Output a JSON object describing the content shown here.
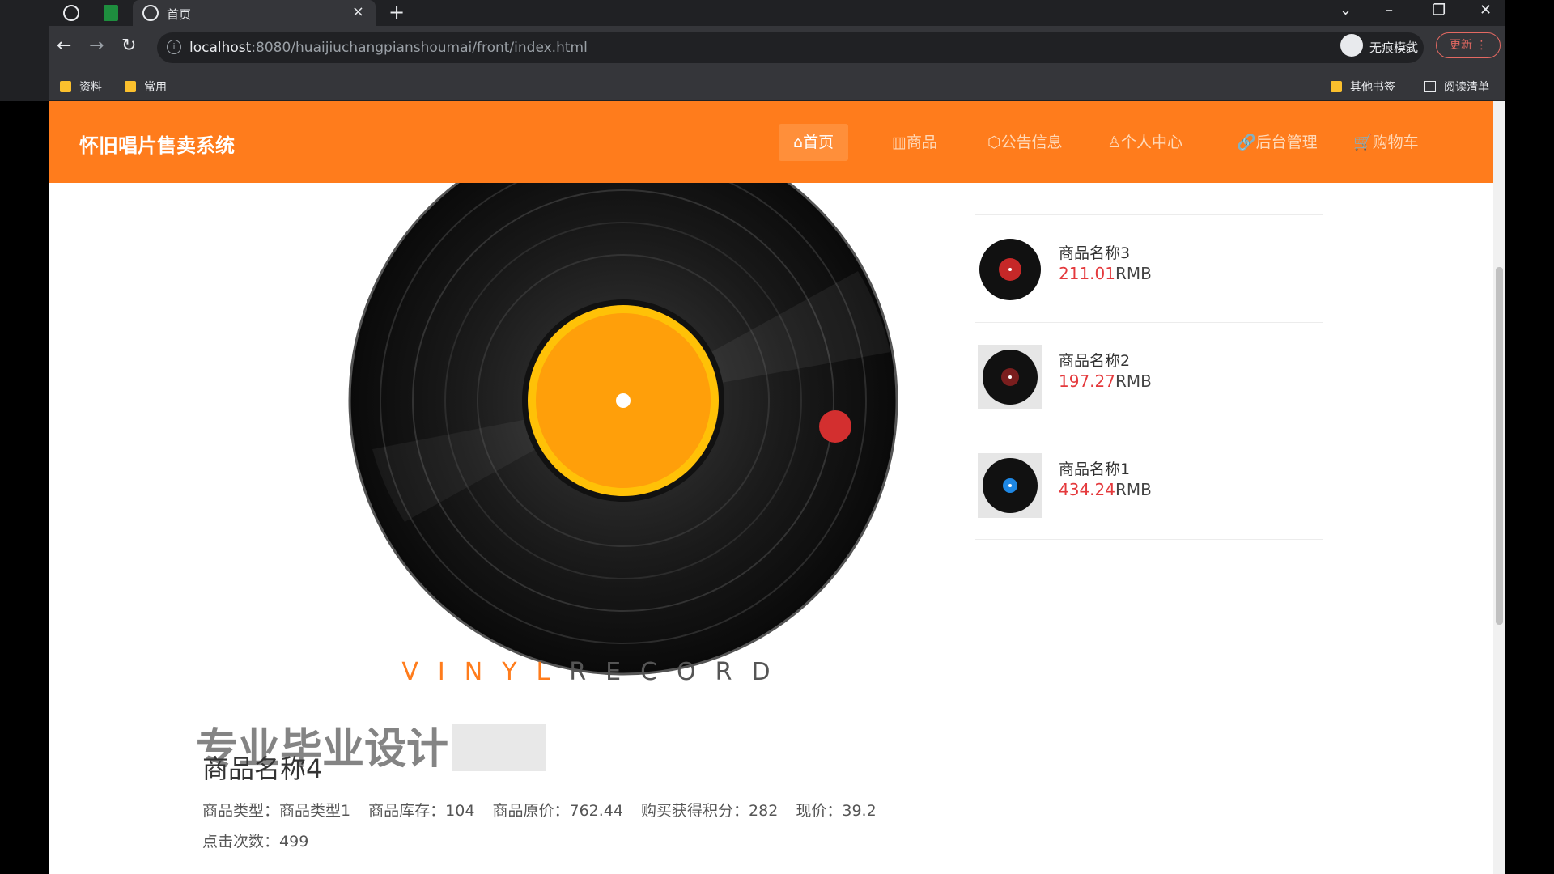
{
  "browser": {
    "tab_title": "首页",
    "tab_close": "×",
    "new_tab": "+",
    "url_host": "localhost",
    "url_rest": ":8080/huaijiuchangpianshoumai/front/index.html",
    "incognito_label": "无痕模式",
    "update_label": "更新 ⋮",
    "bookmarks": [
      "资料",
      "常用"
    ],
    "bookmarks_right": [
      "其他书签",
      "阅读清单"
    ]
  },
  "site": {
    "title": "怀旧唱片售卖系统",
    "nav": [
      {
        "icon": "home-icon",
        "glyph": "⌂",
        "label": "首页"
      },
      {
        "icon": "goods-icon",
        "glyph": "▥",
        "label": "商品"
      },
      {
        "icon": "notice-icon",
        "glyph": "⬡",
        "label": "公告信息"
      },
      {
        "icon": "user-icon",
        "glyph": "♙",
        "label": "个人中心"
      },
      {
        "icon": "admin-icon",
        "glyph": "🔗",
        "label": "后台管理"
      },
      {
        "icon": "cart-icon",
        "glyph": "🛒",
        "label": "购物车"
      }
    ],
    "accent": "#ff7c1c",
    "price_color": "#e4393c"
  },
  "hero": {
    "brand_word1": "VINYL",
    "brand_word2": "RECORD",
    "watermark": "专业毕业设计"
  },
  "product": {
    "name": "商品名称4",
    "fields": [
      {
        "label": "商品类型：",
        "value": "商品类型1"
      },
      {
        "label": "商品库存：",
        "value": "104"
      },
      {
        "label": "商品原价：",
        "value": "762.44"
      },
      {
        "label": "购买获得积分：",
        "value": "282"
      },
      {
        "label": "现价：",
        "value": "39.2"
      }
    ],
    "clicks_label": "点击次数：",
    "clicks_value": "499"
  },
  "sidebar": [
    {
      "name": "商品名称3",
      "price": "211.01",
      "unit": "RMB",
      "label_color": "#c62828"
    },
    {
      "name": "商品名称2",
      "price": "197.27",
      "unit": "RMB",
      "label_color": "#7a1e1e"
    },
    {
      "name": "商品名称1",
      "price": "434.24",
      "unit": "RMB",
      "label_color": "#1e88e5"
    }
  ]
}
